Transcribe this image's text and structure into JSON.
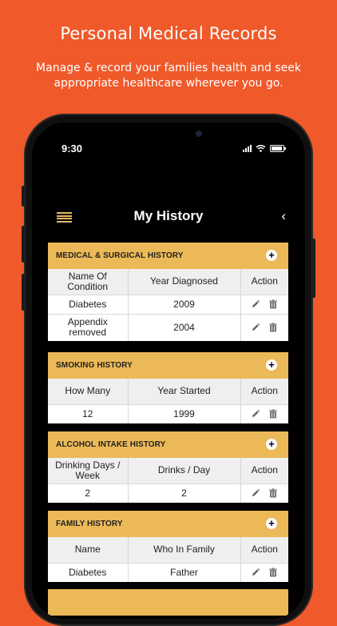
{
  "promo": {
    "title": "Personal Medical Records",
    "subtitle": "Manage & record your families health and seek appropriate healthcare wherever you go."
  },
  "status_bar": {
    "time": "9:30"
  },
  "nav": {
    "title": "My History",
    "back_glyph": "‹"
  },
  "icons": {
    "menu": "hamburger-icon",
    "back": "chevron-left-icon",
    "add": "plus-icon",
    "edit": "pencil-icon",
    "delete": "trash-icon"
  },
  "colors": {
    "background": "#f0592a",
    "section_header": "#ebb957",
    "menu_icon": "#e9b85c"
  },
  "sections": [
    {
      "title": "MEDICAL & SURGICAL HISTORY",
      "add_glyph": "+",
      "columns": [
        "Name Of Condition",
        "Year Diagnosed",
        "Action"
      ],
      "rows": [
        [
          "Diabetes",
          "2009"
        ],
        [
          "Appendix removed",
          "2004"
        ]
      ]
    },
    {
      "title": "SMOKING HISTORY",
      "add_glyph": "+",
      "columns": [
        "How Many",
        "Year Started",
        "Action"
      ],
      "rows": [
        [
          "12",
          "1999"
        ]
      ]
    },
    {
      "title": "ALCOHOL INTAKE HISTORY",
      "add_glyph": "+",
      "columns": [
        "Drinking Days / Week",
        "Drinks / Day",
        "Action"
      ],
      "rows": [
        [
          "2",
          "2"
        ]
      ]
    },
    {
      "title": "FAMILY HISTORY",
      "add_glyph": "+",
      "columns": [
        "Name",
        "Who In Family",
        "Action"
      ],
      "rows": [
        [
          "Diabetes",
          "Father"
        ]
      ]
    }
  ]
}
